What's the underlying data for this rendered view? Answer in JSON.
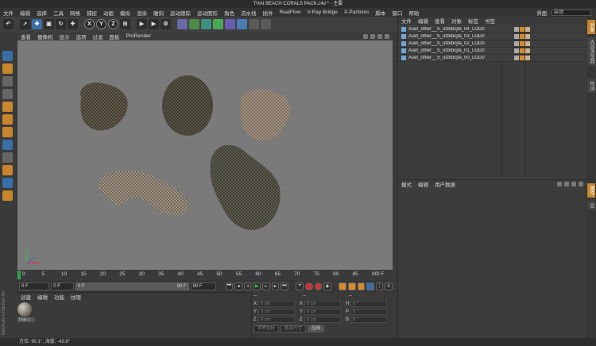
{
  "window": {
    "title": "THAI BEACH CORALS PACK.c4d * - 主要"
  },
  "menu": [
    "文件",
    "编辑",
    "选择",
    "工具",
    "网格",
    "捕捉",
    "动画",
    "模拟",
    "渲染",
    "雕刻",
    "运动跟踪",
    "运动图形",
    "角色",
    "流水线",
    "插件",
    "RealFlow",
    "V-Ray Bridge",
    "X-Particles",
    "脚本",
    "窗口",
    "帮助"
  ],
  "layout": {
    "label": "界面:",
    "value": "启动"
  },
  "toolbar": {
    "axes": [
      "X",
      "Y",
      "Z"
    ]
  },
  "viewport": {
    "menu": [
      "查看",
      "摄像机",
      "显示",
      "选项",
      "过滤",
      "面板",
      "ProRender"
    ]
  },
  "timeline": {
    "ticks": [
      "0",
      "5",
      "10",
      "15",
      "20",
      "25",
      "30",
      "35",
      "40",
      "45",
      "50",
      "55",
      "60",
      "65",
      "70",
      "75",
      "80",
      "85",
      "90"
    ],
    "end_frame_label": "0 F"
  },
  "transport": {
    "current": "0 F",
    "min": "0 F",
    "max": "90 F",
    "end": "90 F",
    "slider_label": "0 F"
  },
  "material": {
    "menu": [
      "创建",
      "编辑",
      "功能",
      "纹理"
    ],
    "items": [
      {
        "name": "Thai 1"
      }
    ]
  },
  "coords": {
    "header": [
      "--",
      "--",
      "--"
    ],
    "rows": [
      {
        "a": "X",
        "av": "0 cm",
        "b": "X",
        "bv": "0 cm",
        "c": "H",
        "cv": "0 °"
      },
      {
        "a": "Y",
        "av": "0 cm",
        "b": "Y",
        "bv": "0 cm",
        "c": "P",
        "cv": "0 °"
      },
      {
        "a": "Z",
        "av": "0 cm",
        "b": "Z",
        "bv": "0 cm",
        "c": "B",
        "cv": "0 °"
      }
    ],
    "buttons": {
      "space": "世界坐标",
      "scale": "绝对尺寸",
      "apply": "应用"
    }
  },
  "status": {
    "text": "方位: 90.1°, 海拔: -43.9°"
  },
  "object_manager": {
    "menu": [
      "文件",
      "编辑",
      "查看",
      "对象",
      "标签",
      "书签"
    ],
    "objects": [
      {
        "name": "Aset_other__S_ufzkbcjfa_04_LOD0"
      },
      {
        "name": "Aset_other__S_ufzkbcjfa_03_LOD0"
      },
      {
        "name": "Aset_other__S_ufzkbcjfa_02_LOD0"
      },
      {
        "name": "Aset_other__S_ufzkbcjfa_01_LOD0"
      },
      {
        "name": "Aset_other__S_ufzkbcjfa_00_LOD0"
      }
    ]
  },
  "attribute_manager": {
    "menu": [
      "模式",
      "编辑",
      "用户数据"
    ]
  },
  "side_tabs": [
    "对象",
    "内容浏览器",
    "构造",
    "属性",
    "层"
  ],
  "branding": {
    "vendor": "MAXON",
    "product": "CINEMA 4D"
  }
}
